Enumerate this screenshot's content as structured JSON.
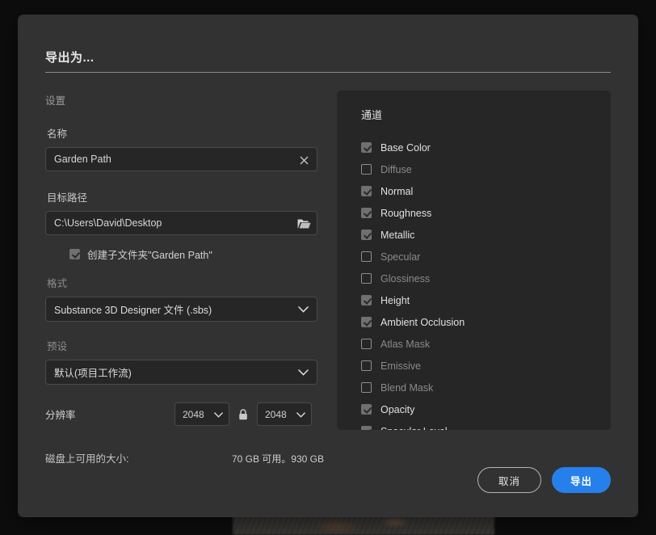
{
  "dialog": {
    "title": "导出为...",
    "settings_heading": "设置",
    "name": {
      "label": "名称",
      "value": "Garden Path",
      "placeholder": "名称",
      "clear_icon": "close-icon"
    },
    "target_path": {
      "label": "目标路径",
      "value": "C:\\Users\\David\\Desktop",
      "placeholder": "目标路径",
      "browse_icon": "folder-icon"
    },
    "subfolder": {
      "label": "创建子文件夹\"Garden Path\"",
      "checked": true
    },
    "format": {
      "label": "格式",
      "value": "Substance 3D Designer 文件 (.sbs)"
    },
    "preset": {
      "label": "预设",
      "value": "默认(项目工作流)"
    },
    "resolution": {
      "label": "分辨率",
      "width": "2048",
      "height": "2048",
      "lock_icon": "lock-closed-icon",
      "locked": true
    },
    "disk": {
      "label": "磁盘上可用的大小:",
      "value": "70 GB 可用。930 GB"
    }
  },
  "channels": {
    "title": "通道",
    "items": [
      {
        "label": "Base Color",
        "checked": true
      },
      {
        "label": "Diffuse",
        "checked": false
      },
      {
        "label": "Normal",
        "checked": true
      },
      {
        "label": "Roughness",
        "checked": true
      },
      {
        "label": "Metallic",
        "checked": true
      },
      {
        "label": "Specular",
        "checked": false
      },
      {
        "label": "Glossiness",
        "checked": false
      },
      {
        "label": "Height",
        "checked": true
      },
      {
        "label": "Ambient Occlusion",
        "checked": true
      },
      {
        "label": "Atlas Mask",
        "checked": false
      },
      {
        "label": "Emissive",
        "checked": false
      },
      {
        "label": "Blend Mask",
        "checked": false
      },
      {
        "label": "Opacity",
        "checked": true
      },
      {
        "label": "Specular Level",
        "checked": true
      }
    ]
  },
  "footer": {
    "cancel_label": "取消",
    "export_label": "导出"
  },
  "colors": {
    "accent": "#2680eb",
    "dialog_bg": "#323232",
    "panel_bg": "#262626",
    "backdrop": "#0d0d0d"
  }
}
